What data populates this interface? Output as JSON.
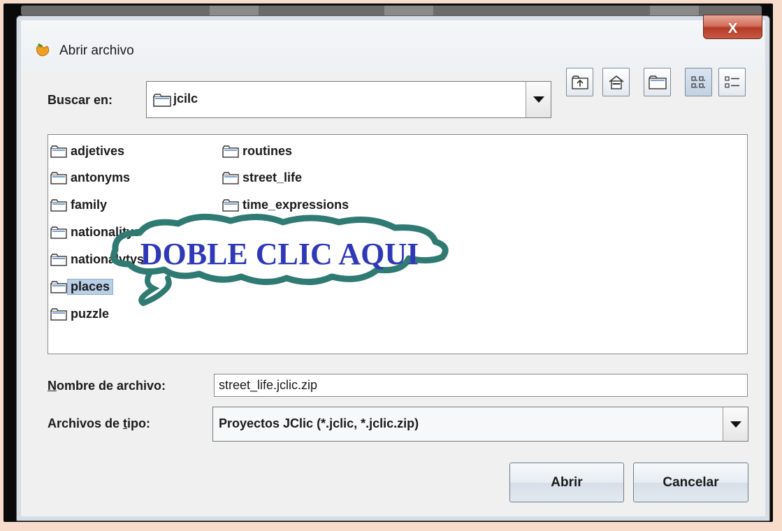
{
  "window": {
    "title": "Abrir archivo",
    "close_label": "X"
  },
  "lookin": {
    "label": "Buscar en:",
    "value": "jcilc"
  },
  "toolbar": {
    "icons": [
      "up-folder-icon",
      "home-icon",
      "new-folder-icon",
      "list-view-icon",
      "details-view-icon"
    ]
  },
  "files": {
    "col1": [
      "adjetives",
      "antonyms",
      "family",
      "nationalitys",
      "nationalytys",
      "places",
      "puzzle"
    ],
    "col2": [
      "routines",
      "street_life",
      "time_expressions"
    ],
    "selected": "places"
  },
  "overlay": {
    "text": "DOBLE CLIC AQUI",
    "text_color": "#2f39b8",
    "cloud_color": "#2f7a72"
  },
  "filename": {
    "label_first": "N",
    "label_rest": "ombre de archivo:",
    "value": "street_life.jclic.zip"
  },
  "filetype": {
    "label_before": "Archivos de ",
    "label_u": "t",
    "label_after": "ipo:",
    "value": "Proyectos JClic (*.jclic, *.jclic.zip)"
  },
  "buttons": {
    "open": "Abrir",
    "cancel": "Cancelar"
  }
}
